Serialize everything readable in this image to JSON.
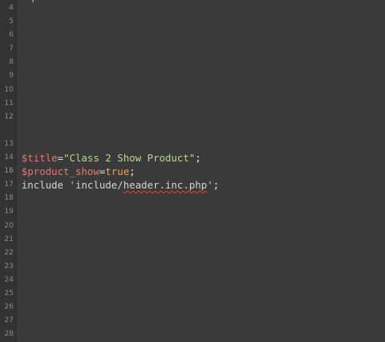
{
  "editor": {
    "line_numbers": [
      "4",
      "5",
      "6",
      "7",
      "8",
      "9",
      "10",
      "11",
      "12",
      "13",
      "14",
      "15",
      "16",
      "17",
      "18",
      "19",
      "20",
      "21",
      "22",
      "23",
      "24",
      "25",
      "26",
      "27",
      "28"
    ],
    "code": {
      "l13_var": "$title",
      "l13_eq": "=",
      "l13_str": "\"Class 2 Show Product\"",
      "l13_semi": ";",
      "l14_var": "$product_show",
      "l14_eq": "=",
      "l14_kw": "true",
      "l14_semi": ";",
      "l15_kw": "include ",
      "l15_str_a": "'include/",
      "l15_str_b": "header.inc.php",
      "l15_str_c": "'",
      "l15_semi": ";"
    },
    "colors": {
      "background": "#3a3a3a",
      "variable": "#e8756f",
      "string": "#b5d98a",
      "keyword": "#f0a24c",
      "spell_error": "#e0443a"
    }
  }
}
